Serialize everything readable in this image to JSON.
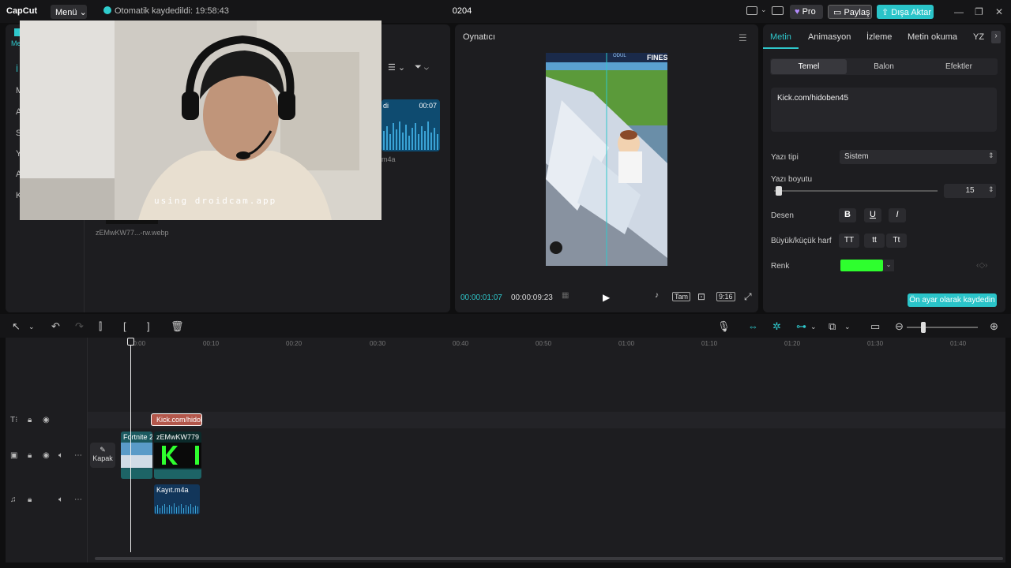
{
  "app": {
    "logo": "CapCut",
    "menu_label": "Menü ⌄",
    "autosave": "Otomatik kaydedildi: 19:58:43",
    "project_title": "0204",
    "pro_label": "Pro",
    "share_label": "Paylaş",
    "export_label": "Dışa Aktar"
  },
  "media": {
    "nav_letters": [
      "İ",
      "M",
      "A",
      "S",
      "Y",
      "A",
      "K"
    ],
    "thumb_duration": "00:07",
    "thumb_caption": "m4a",
    "file_label": "zEMwKW77...-rw.webp",
    "partial_label": "di"
  },
  "webcam": {
    "overlay_text": "using droidcam.app"
  },
  "player": {
    "title": "Oynatıcı",
    "current_time": "00:00:01:07",
    "total_time": "00:00:09:23",
    "full_label": "Tam",
    "ratio_label": "9:16",
    "hud_text": "FINES",
    "hud_small": "ÖDÜL"
  },
  "inspector": {
    "tabs": [
      "Metin",
      "Animasyon",
      "İzleme",
      "Metin okuma",
      "YZ"
    ],
    "subtabs": [
      "Temel",
      "Balon",
      "Efektler"
    ],
    "text_value": "Kick.com/hidoben45",
    "font_label": "Yazı tipi",
    "font_value": "Sistem",
    "size_label": "Yazı boyutu",
    "size_value": "15",
    "pattern_label": "Desen",
    "pattern_buttons": [
      "B",
      "U",
      "I"
    ],
    "case_label": "Büyük/küçük harf",
    "case_buttons": [
      "TT",
      "tt",
      "Tt"
    ],
    "color_label": "Renk",
    "color_value": "#2eff2e",
    "save_preset": "Ön ayar olarak kaydedin"
  },
  "timeline": {
    "ruler": [
      "00:00",
      "00:10",
      "00:20",
      "00:30",
      "00:40",
      "00:50",
      "01:00",
      "01:10",
      "01:20",
      "01:30",
      "01:40"
    ],
    "text_clip": "Kick.com/hidob",
    "video_clip1": "Fortnite 2",
    "video_clip2": "zEMwKW779",
    "audio_clip": "Kayıt.m4a",
    "cover_label": "Kapak"
  },
  "colors": {
    "accent": "#2ac4c9",
    "panel": "#1d1d20",
    "text_clip": "#b3574b"
  }
}
